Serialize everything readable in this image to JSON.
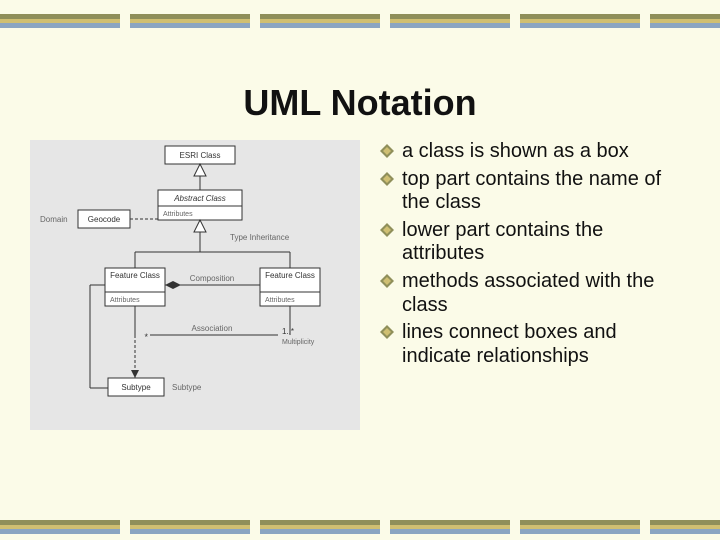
{
  "title": "UML Notation",
  "bullets": [
    "a class is shown as a box",
    "top part contains the name of the class",
    "lower part contains the attributes",
    "methods associated with the class",
    "lines connect boxes and indicate relationships"
  ],
  "diagram": {
    "esri_class": "ESRI Class",
    "abstract_class": "Abstract Class",
    "abstract_attr": "Attributes",
    "type_inheritance": "Type Inheritance",
    "domain": "Domain",
    "geocode": "Geocode",
    "feature_class": "Feature Class",
    "feature_attr": "Attributes",
    "feature_class2": "Feature Class",
    "feature_attr2": "Attributes",
    "composition": "Composition",
    "assoc_left": "*",
    "association": "Association",
    "assoc_right_n": "1..*",
    "assoc_right_m": "Multiplicity",
    "subtype": "Subtype"
  },
  "colors": {
    "olive": "#8f8f5a",
    "gold": "#cfbf72",
    "blue": "#8aa5c2"
  }
}
